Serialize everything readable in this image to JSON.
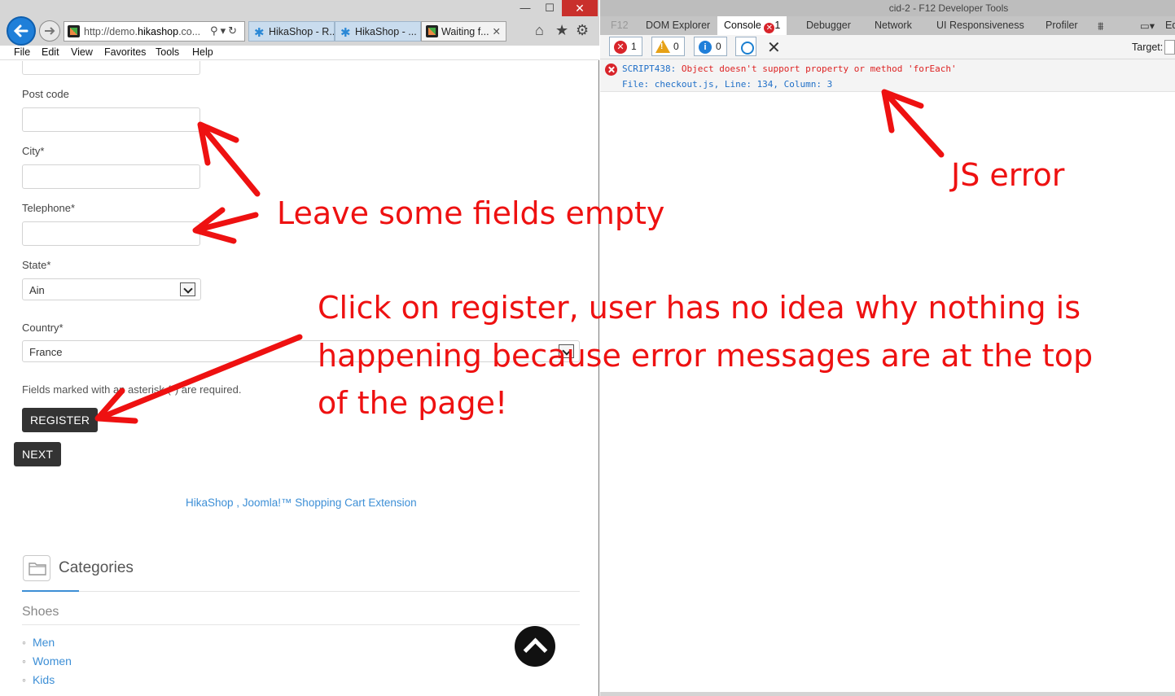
{
  "browser": {
    "address_url_dim": "http://demo.",
    "address_url_bold": "hikashop",
    "address_url_rest": ".co...",
    "tabs": [
      {
        "label": "HikaShop - R..."
      },
      {
        "label": "HikaShop - ..."
      },
      {
        "label": "Waiting f..."
      }
    ],
    "menu": [
      "File",
      "Edit",
      "View",
      "Favorites",
      "Tools",
      "Help"
    ]
  },
  "form": {
    "postcode_label": "Post code",
    "city_label": "City*",
    "telephone_label": "Telephone*",
    "state_label": "State*",
    "state_value": "Ain",
    "country_label": "Country*",
    "country_value": "France",
    "required_note": "Fields marked with an asterisk (*) are required.",
    "register_label": "REGISTER",
    "next_label": "NEXT"
  },
  "footer": {
    "extension_link": "HikaShop , Joomla!™ Shopping Cart Extension"
  },
  "categories": {
    "title": "Categories",
    "group": "Shoes",
    "items": [
      "Men",
      "Women",
      "Kids"
    ]
  },
  "devtools": {
    "window_title": "cid-2 - F12 Developer Tools",
    "tabs": [
      "F12",
      "DOM Explorer",
      "Console",
      "Debugger",
      "Network",
      "UI Responsiveness",
      "Profiler",
      "Ed"
    ],
    "console_error_badge": "1",
    "counts": {
      "errors": "1",
      "warnings": "0",
      "messages": "0"
    },
    "target_label": "Target:",
    "error_code": "SCRIPT438:",
    "error_message": "Object doesn't support property or method 'forEach'",
    "error_location": "File: checkout.js, Line: 134, Column: 3"
  },
  "annotations": {
    "empty_fields": "Leave some fields empty",
    "register_line1": "Click on register, user has no idea why nothing is",
    "register_line2": "happening because error messages are at the top",
    "register_line3": "of the page!",
    "js_error": "JS error"
  },
  "colors": {
    "annotation": "#e11111",
    "link": "#3d8fd6",
    "dark_button": "#333333",
    "error": "#d8242a"
  }
}
